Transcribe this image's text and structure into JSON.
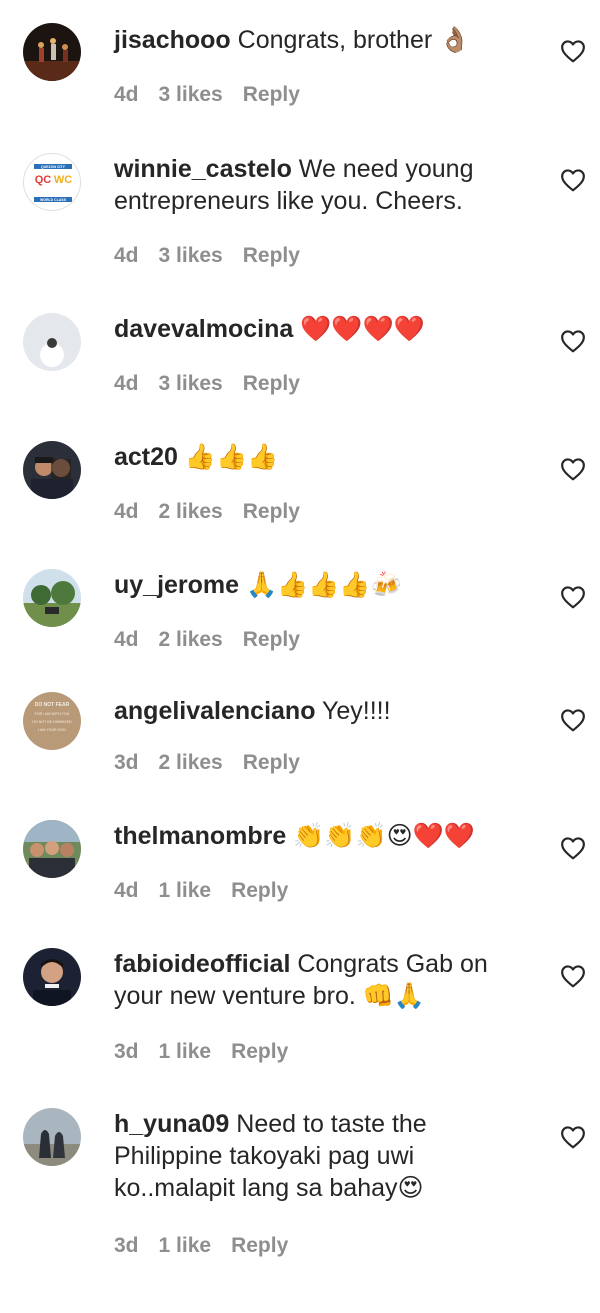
{
  "comments": [
    {
      "username": "jisachooo",
      "text": " Congrats, brother 👌🏽",
      "age": "4d",
      "likes": "3 likes",
      "reply": "Reply"
    },
    {
      "username": "winnie_castelo",
      "text": " We need young entrepreneurs like you. Cheers.",
      "age": "4d",
      "likes": "3 likes",
      "reply": "Reply"
    },
    {
      "username": "davevalmocina",
      "text": " ❤️❤️❤️❤️",
      "age": "4d",
      "likes": "3 likes",
      "reply": "Reply"
    },
    {
      "username": "act20",
      "text": " 👍👍👍",
      "age": "4d",
      "likes": "2 likes",
      "reply": "Reply"
    },
    {
      "username": "uy_jerome",
      "text": " 🙏👍👍👍🍻",
      "age": "4d",
      "likes": "2 likes",
      "reply": "Reply"
    },
    {
      "username": "angelivalenciano",
      "text": " Yey!!!!",
      "age": "3d",
      "likes": "2 likes",
      "reply": "Reply"
    },
    {
      "username": "thelmanombre",
      "text": " 👏👏👏😍❤️❤️",
      "age": "4d",
      "likes": "1 like",
      "reply": "Reply"
    },
    {
      "username": "fabioideofficial",
      "text": " Congrats Gab on your new venture bro. 👊🙏",
      "age": "3d",
      "likes": "1 like",
      "reply": "Reply"
    },
    {
      "username": "h_yuna09",
      "text": " Need to taste the Philippine takoyaki pag uwi ko..malapit lang sa bahay😍",
      "age": "3d",
      "likes": "1 like",
      "reply": "Reply"
    }
  ],
  "avatar_logo": {
    "top": "QUEZON CITY",
    "left": "QC",
    "right": "WC",
    "bottom": "WORLD CLASS"
  },
  "avatar_sign": {
    "lines": [
      "DO NOT FEAR",
      "FOR I AM WITH YOU",
      "DO NOT BE DISMAYED",
      "I AM YOUR GOD"
    ]
  },
  "colors": {
    "text": "#262626",
    "meta": "#8e8e8e",
    "heart_outline": "#262626"
  },
  "icons": {
    "like": "heart-outline-icon"
  }
}
